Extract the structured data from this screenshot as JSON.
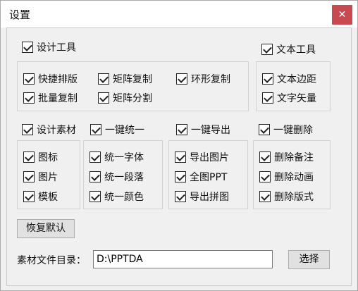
{
  "window": {
    "title": "设置",
    "close_glyph": "✕"
  },
  "top_row": {
    "design_tools": {
      "label": "设计工具",
      "checked": true
    },
    "text_tools": {
      "label": "文本工具",
      "checked": true
    }
  },
  "design_tools_group": [
    {
      "label": "快捷排版",
      "checked": true
    },
    {
      "label": "矩阵复制",
      "checked": true
    },
    {
      "label": "环形复制",
      "checked": true
    },
    {
      "label": "批量复制",
      "checked": true
    },
    {
      "label": "矩阵分割",
      "checked": true
    }
  ],
  "text_tools_group": [
    {
      "label": "文本边距",
      "checked": true
    },
    {
      "label": "文字矢量",
      "checked": true
    }
  ],
  "middle_row": {
    "design_material": {
      "label": "设计素材",
      "checked": true
    },
    "unify": {
      "label": "一键统一",
      "checked": true
    },
    "export": {
      "label": "一键导出",
      "checked": true
    },
    "delete": {
      "label": "一键删除",
      "checked": true
    }
  },
  "material_group": [
    {
      "label": "图标",
      "checked": true
    },
    {
      "label": "图片",
      "checked": true
    },
    {
      "label": "模板",
      "checked": true
    }
  ],
  "unify_group": [
    {
      "label": "统一字体",
      "checked": true
    },
    {
      "label": "统一段落",
      "checked": true
    },
    {
      "label": "统一颜色",
      "checked": true
    }
  ],
  "export_group": [
    {
      "label": "导出图片",
      "checked": true
    },
    {
      "label": "全图PPT",
      "checked": true
    },
    {
      "label": "导出拼图",
      "checked": true
    }
  ],
  "delete_group": [
    {
      "label": "删除备注",
      "checked": true
    },
    {
      "label": "删除动画",
      "checked": true
    },
    {
      "label": "删除版式",
      "checked": true
    }
  ],
  "restore_button": "恢复默认",
  "material_dir": {
    "label": "素材文件目录：",
    "value": "D:\\PPTDA"
  },
  "select_button": "选择",
  "colors": {
    "close_bg": "#c64a4f",
    "window_bg": "#f0f0f0"
  }
}
